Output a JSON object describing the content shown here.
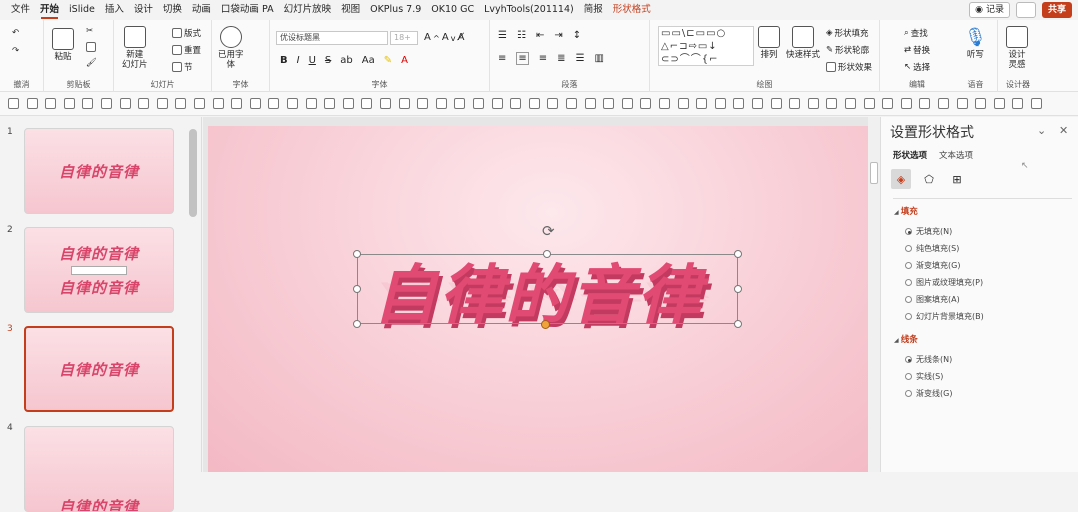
{
  "tabs": [
    "文件",
    "开始",
    "iSlide",
    "插入",
    "设计",
    "切换",
    "动画",
    "口袋动画 PA",
    "幻灯片放映",
    "视图",
    "OKPlus 7.9",
    "OK10 GC",
    "LvyhTools(201114)",
    "简报",
    "形状格式"
  ],
  "active_tab": "开始",
  "context_tab": "形状格式",
  "titlebar": {
    "record_label": "记录",
    "share_label": "共享"
  },
  "ribbon": {
    "groups": {
      "undo": "撤消",
      "clipboard": "剪贴板",
      "slides": "幻灯片",
      "font": "字体",
      "paragraph": "段落",
      "drawing": "绘图",
      "editing": "编辑",
      "voice": "语音",
      "designer": "设计器"
    },
    "paste_label": "粘贴",
    "new_slide_label": "新建\n幻灯片",
    "layout_label": "版式",
    "reset_label": "重置",
    "section_label": "节",
    "used_font_label": "已用字\n体",
    "font_name": "优设标题黑",
    "font_size": "18+",
    "arrange_label": "排列",
    "quick_style_label": "快速样式",
    "shape_fill_label": "形状填充",
    "shape_outline_label": "形状轮廓",
    "shape_effect_label": "形状效果",
    "find_label": "查找",
    "replace_label": "替换",
    "select_label": "选择",
    "dictate_label": "听写",
    "design_ideas_label": "设计\n灵感",
    "shapes_gallery": [
      "▭▭\\⊏▭▭○",
      "△⌐⊐⇨▭↓",
      "⊂⊃⌒⌒{⌐"
    ]
  },
  "slides": [
    {
      "number": "1",
      "lines": [
        "自律的音律"
      ]
    },
    {
      "number": "2",
      "lines": [
        "自律的音律",
        "自律的音律"
      ]
    },
    {
      "number": "3",
      "lines": [
        "自律的音律"
      ]
    },
    {
      "number": "4",
      "lines": [
        "自律的音律"
      ]
    }
  ],
  "selected_slide": "3",
  "canvas": {
    "title": "自律的音律"
  },
  "pane": {
    "title": "设置形状格式",
    "tab_shape": "形状选项",
    "tab_text": "文本选项",
    "fill_header": "填充",
    "fill_options": [
      "无填充(N)",
      "纯色填充(S)",
      "渐变填充(G)",
      "图片或纹理填充(P)",
      "图案填充(A)",
      "幻灯片背景填充(B)"
    ],
    "line_header": "线条",
    "line_options": [
      "无线条(N)",
      "实线(S)",
      "渐变线(G)"
    ]
  }
}
